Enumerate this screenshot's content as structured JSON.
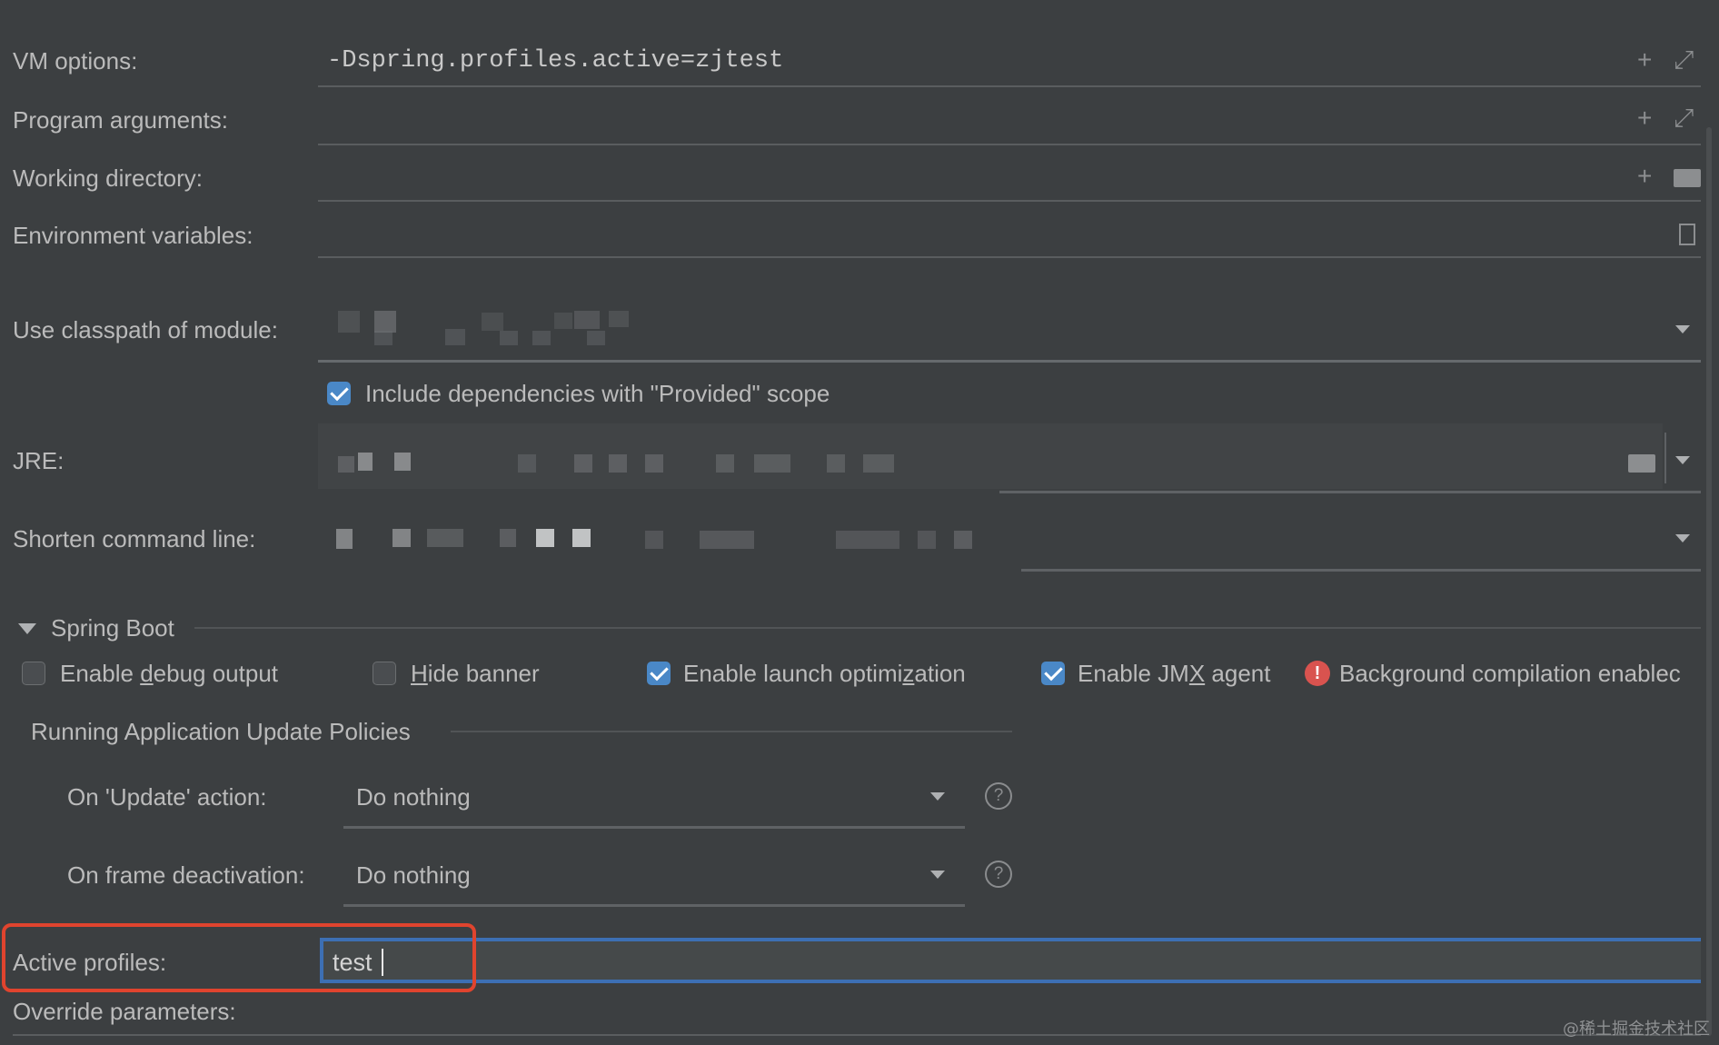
{
  "fields": {
    "vm_options_label": "VM options:",
    "vm_options_value": "-Dspring.profiles.active=zjtest",
    "program_arguments_label": "Program arguments:",
    "working_directory_label": "Working directory:",
    "environment_variables_label": "Environment variables:",
    "classpath_label": "Use classpath of module:",
    "include_provided_label": "Include dependencies with \"Provided\" scope",
    "include_provided_checked": true,
    "jre_label": "JRE:",
    "shorten_label": "Shorten command line:"
  },
  "spring_boot": {
    "title": "Spring Boot",
    "options": [
      {
        "label_pre": "Enable ",
        "label_mn": "d",
        "label_post": "ebug output",
        "checked": false
      },
      {
        "label_pre": "",
        "label_mn": "H",
        "label_post": "ide banner",
        "checked": false
      },
      {
        "label_pre": "Enable launch optimi",
        "label_mn": "z",
        "label_post": "ation",
        "checked": true
      },
      {
        "label_pre": "Enable JM",
        "label_mn": "X",
        "label_post": " agent",
        "checked": true
      }
    ],
    "warning_text": "Background compilation enablec",
    "policies_title": "Running Application Update Policies",
    "update_action_label": "On 'Update' action:",
    "update_action_value": "Do nothing",
    "frame_deactivation_label": "On frame deactivation:",
    "frame_deactivation_value": "Do nothing",
    "help_glyph": "?"
  },
  "profiles": {
    "active_profiles_label": "Active profiles:",
    "active_profiles_value": "test",
    "override_parameters_label": "Override parameters:"
  },
  "watermark": "@稀土掘金技术社区",
  "colors": {
    "background": "#3c3f41",
    "accent": "#4a88c7",
    "focus_border": "#3d6fb3",
    "highlight": "#e0442e",
    "warning": "#d9534f"
  }
}
